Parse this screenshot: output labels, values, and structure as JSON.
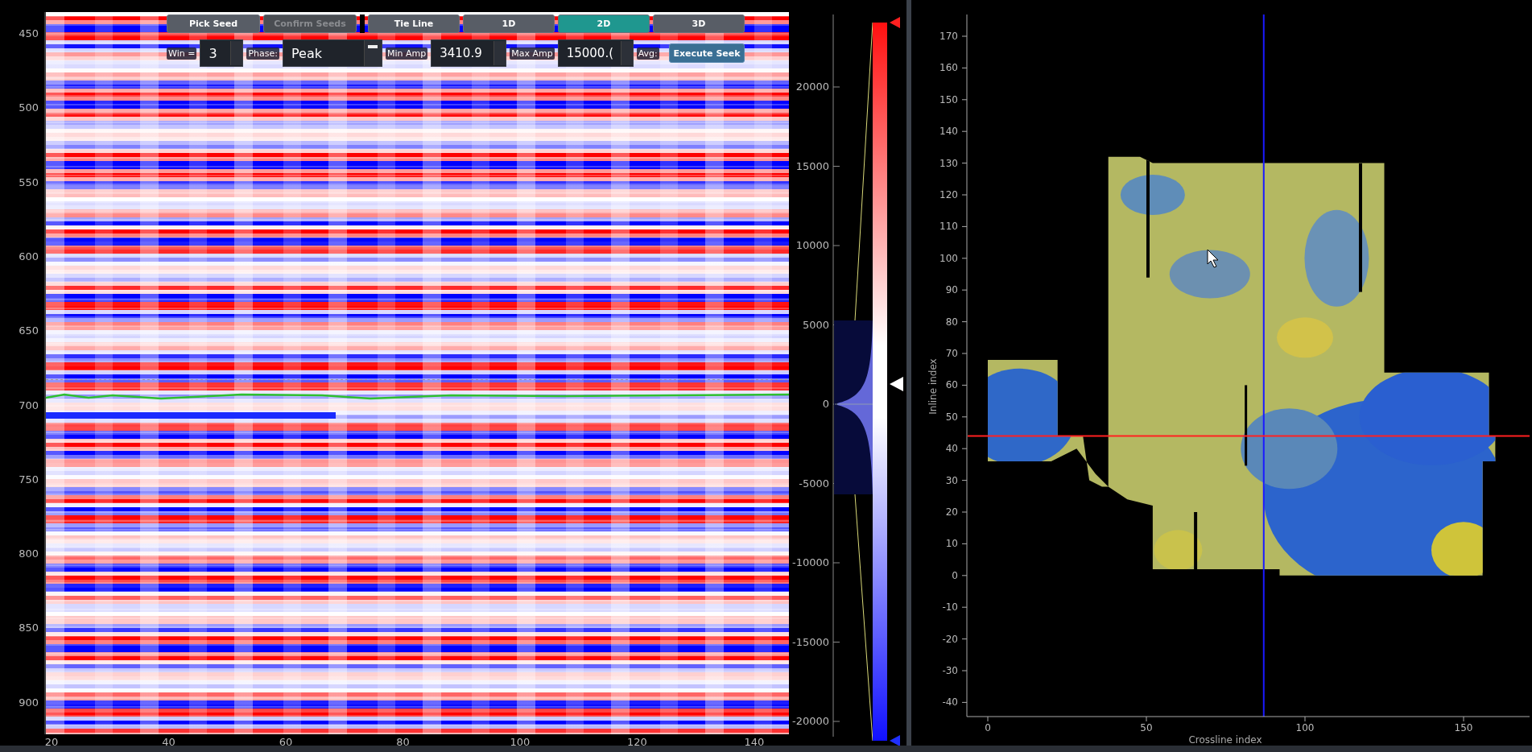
{
  "seismic_view": {
    "toolbar": {
      "actions": [
        {
          "label": "Pick Seed",
          "disabled": false
        },
        {
          "label": "Confirm Seeds",
          "disabled": true
        }
      ],
      "modes": [
        {
          "label": "Tie Line",
          "selected": false
        },
        {
          "label": "1D",
          "selected": false
        },
        {
          "label": "2D",
          "selected": true
        },
        {
          "label": "3D",
          "selected": false
        }
      ],
      "win": {
        "label": "Win =",
        "value": "3"
      },
      "phase": {
        "label": "Phase:",
        "value": "Peak"
      },
      "min_amp": {
        "label": "Min Amp",
        "value": "3410.9"
      },
      "max_amp": {
        "label": "Max Amp",
        "value": "15000.("
      },
      "avg": {
        "label": "Avg:"
      },
      "execute": {
        "label": "Execute Seek"
      }
    },
    "y_ticks": [
      "450",
      "500",
      "550",
      "600",
      "650",
      "700",
      "750",
      "800",
      "850",
      "900"
    ],
    "x_ticks": [
      "20",
      "40",
      "60",
      "80",
      "100",
      "120",
      "140"
    ],
    "colorbar": {
      "ticks": [
        "20000",
        "15000",
        "10000",
        "5000",
        "0",
        "-5000",
        "-10000",
        "-15000",
        "-20000"
      ]
    }
  },
  "map_view": {
    "y_label": "Inline index",
    "x_label": "Crossline index",
    "y_ticks": [
      "170",
      "160",
      "150",
      "140",
      "130",
      "120",
      "110",
      "100",
      "90",
      "80",
      "70",
      "60",
      "50",
      "40",
      "30",
      "20",
      "10",
      "0",
      "-10",
      "-20",
      "-30",
      "-40"
    ],
    "x_ticks": [
      "0",
      "50",
      "100",
      "150"
    ]
  }
}
